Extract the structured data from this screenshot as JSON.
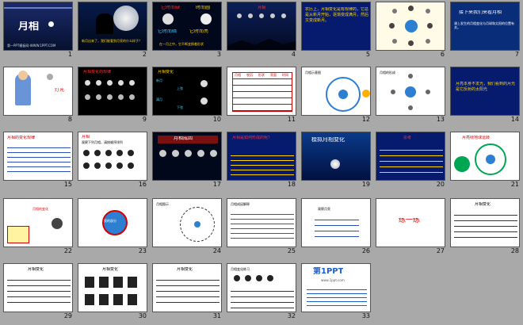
{
  "view": "slide-sorter",
  "slides": [
    {
      "num": "1",
      "title": "月相",
      "sub": "第一PPT模板网-WWW.1PPT.COM"
    },
    {
      "num": "2",
      "text": "新月出来了，我们能看到月亮的什么样子？"
    },
    {
      "num": "3",
      "labels": [
        "它时而缺",
        "时而圆",
        "它时而暗",
        "它时而亮",
        "时而缺"
      ],
      "foot": "在一月之中，它不断变换着形状"
    },
    {
      "num": "4",
      "text": "月相"
    },
    {
      "num": "5",
      "text": "农历上，月相变化是有规律的，它总是从新月开始，逐渐变成满月，然后又变成新月。"
    },
    {
      "num": "6",
      "text": "月相图"
    },
    {
      "num": "7",
      "title": "接下来我们来看月相",
      "text": "课上发生的月相变化与月球和太阳的位置有关。"
    },
    {
      "num": "8",
      "label": "灯光"
    },
    {
      "num": "9",
      "title": "月相变化的规律"
    },
    {
      "num": "10",
      "title": "月相变化",
      "labels": [
        "新月",
        "上弦",
        "满月",
        "下弦"
      ]
    },
    {
      "num": "11",
      "headers": [
        "月相",
        "农历",
        "形状",
        "亮面",
        "时间"
      ]
    },
    {
      "num": "12",
      "text": "月相示意图"
    },
    {
      "num": "13",
      "text": "月相的形成"
    },
    {
      "num": "14",
      "text": "月亮本身不发光，我们看到的月光是它反射的太阳光"
    },
    {
      "num": "15",
      "text": "月相的变化规律"
    },
    {
      "num": "16",
      "title": "月相",
      "text": "观察下列月相，请按顺序排列"
    },
    {
      "num": "17",
      "title": "月相成因"
    },
    {
      "num": "18",
      "title": "月相是如何形成的呢？"
    },
    {
      "num": "19",
      "title": "模拟月相变化"
    },
    {
      "num": "20",
      "title": "思考"
    },
    {
      "num": "21",
      "title": "月亮绕地球运转"
    },
    {
      "num": "22",
      "label": "月相的变化"
    },
    {
      "num": "23",
      "label": "亮的部分"
    },
    {
      "num": "24",
      "text": "月相图示"
    },
    {
      "num": "25",
      "text": "月相成因解释"
    },
    {
      "num": "26",
      "text": "观察月亮"
    },
    {
      "num": "27",
      "title": "练一练"
    },
    {
      "num": "28",
      "title": "月相变化"
    },
    {
      "num": "29",
      "title": "月相变化"
    },
    {
      "num": "30",
      "title": "月相变化"
    },
    {
      "num": "31",
      "title": "月相变化"
    },
    {
      "num": "32",
      "text": "月相变化练习"
    },
    {
      "num": "33",
      "brand": "第1PPT",
      "sub": "www.1ppt.com"
    }
  ],
  "colors": {
    "background": "#a9a9a9",
    "dark_slide": "#0b1440",
    "title_red": "#d40000",
    "accent_yellow": "#ffd400",
    "accent_green": "#00a651"
  }
}
